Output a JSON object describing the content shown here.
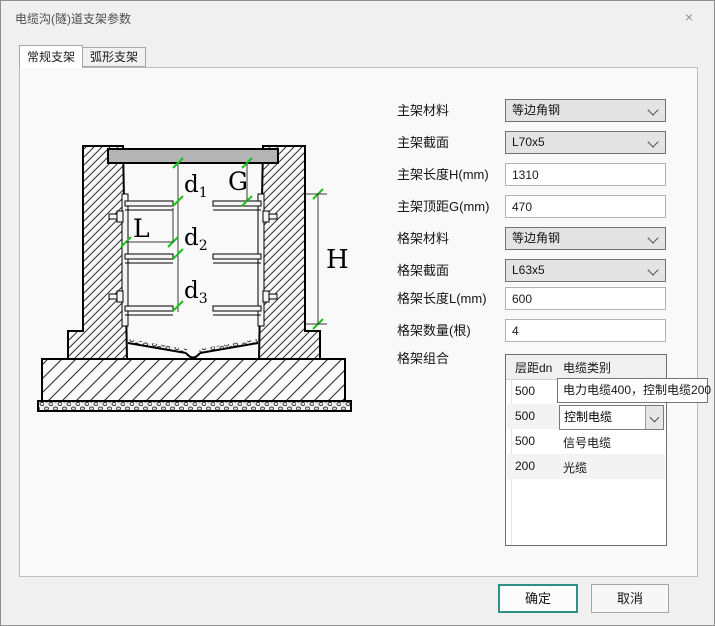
{
  "window": {
    "title": "电缆沟(隧)道支架参数",
    "close_glyph": "×"
  },
  "tabs": {
    "tab1": "常规支架",
    "tab2": "弧形支架"
  },
  "form": {
    "fields": [
      {
        "label": "主架材料",
        "value": "等边角钢"
      },
      {
        "label": "主架截面",
        "value": "L70x5"
      },
      {
        "label": "主架长度H(mm)",
        "value": "1310"
      },
      {
        "label": "主架顶距G(mm)",
        "value": "470"
      },
      {
        "label": "格架材料",
        "value": "等边角钢"
      },
      {
        "label": "格架截面",
        "value": "L63x5"
      },
      {
        "label": "格架长度L(mm)",
        "value": "600"
      },
      {
        "label": "格架数量(根)",
        "value": "4"
      }
    ],
    "group_label": "格架组合"
  },
  "table": {
    "headers": {
      "dn": "层距dn",
      "category": "电缆类别"
    },
    "rows": [
      {
        "dn": "500",
        "category": ""
      },
      {
        "dn": "500",
        "category": "控制电缆"
      },
      {
        "dn": "500",
        "category": "信号电缆"
      },
      {
        "dn": "200",
        "category": "光缆"
      }
    ],
    "tooltip": "电力电缆400，控制电缆200"
  },
  "buttons": {
    "ok": "确定",
    "cancel": "取消"
  },
  "diagram": {
    "d": "d",
    "sub1": "1",
    "sub2": "2",
    "sub3": "3",
    "g": "G",
    "h": "H",
    "l": "L"
  },
  "colors": {
    "accent_teal": "#2e9183",
    "tick_green": "#17c417",
    "slab_gray": "#b4b4b4"
  }
}
